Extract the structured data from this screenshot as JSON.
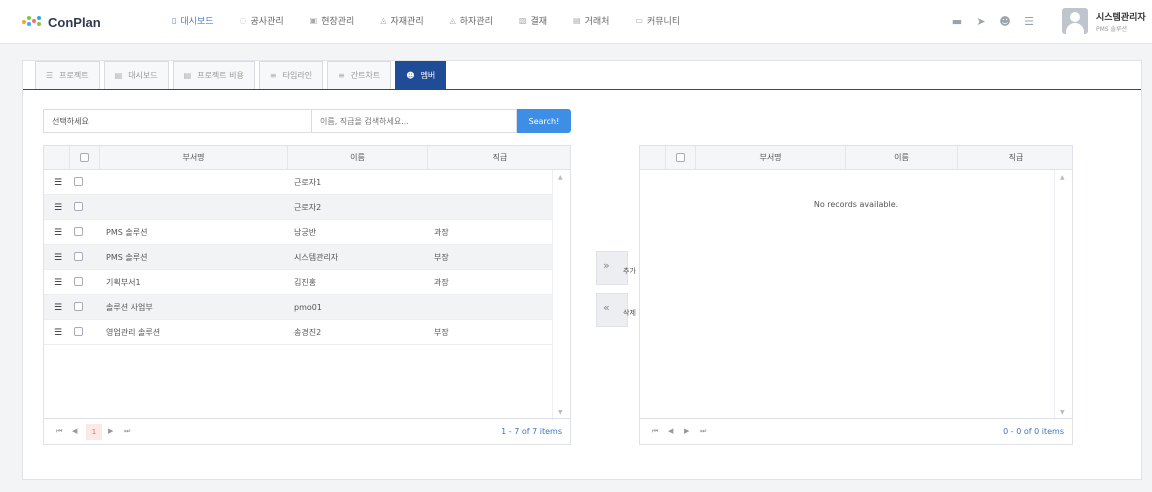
{
  "app": {
    "name": "ConPlan"
  },
  "nav": [
    {
      "label": "대시보드",
      "icon": "dashboard-icon",
      "glyph": "▯",
      "active": true
    },
    {
      "label": "공사관리",
      "icon": "circle-icon",
      "glyph": "◌",
      "active": false
    },
    {
      "label": "현장관리",
      "icon": "site-icon",
      "glyph": "▣",
      "active": false
    },
    {
      "label": "자재관리",
      "icon": "material-icon",
      "glyph": "◬",
      "active": false
    },
    {
      "label": "하자관리",
      "icon": "defect-icon",
      "glyph": "◬",
      "active": false
    },
    {
      "label": "결재",
      "icon": "approval-icon",
      "glyph": "▨",
      "active": false
    },
    {
      "label": "거래처",
      "icon": "client-icon",
      "glyph": "▤",
      "active": false
    },
    {
      "label": "커뮤니티",
      "icon": "community-icon",
      "glyph": "▭",
      "active": false
    }
  ],
  "user": {
    "name": "시스템관리자",
    "role": "PMS 솔루션"
  },
  "tabs": [
    {
      "label": "프로젝트",
      "icon": "list-icon",
      "glyph": "☰",
      "active": false
    },
    {
      "label": "대시보드",
      "icon": "doc-icon",
      "glyph": "▤",
      "active": false
    },
    {
      "label": "프로젝트 비용",
      "icon": "doc-icon",
      "glyph": "▤",
      "active": false
    },
    {
      "label": "타임라인",
      "icon": "timeline-icon",
      "glyph": "≡",
      "active": false
    },
    {
      "label": "간트차트",
      "icon": "gantt-icon",
      "glyph": "≡",
      "active": false
    },
    {
      "label": "멤버",
      "icon": "members-icon",
      "glyph": "☻",
      "active": true
    }
  ],
  "filter": {
    "select_value": "선택하세요",
    "search_placeholder": "이름, 직급을 검색하세요...",
    "search_label": "Search!"
  },
  "left_grid": {
    "columns": [
      "부서명",
      "이름",
      "직급"
    ],
    "rows": [
      {
        "dept": "",
        "name": "근로자1",
        "rank": ""
      },
      {
        "dept": "",
        "name": "근로자2",
        "rank": ""
      },
      {
        "dept": "PMS 솔루션",
        "name": "남궁반",
        "rank": "과장"
      },
      {
        "dept": "PMS 솔루션",
        "name": "시스템관리자",
        "rank": "부장"
      },
      {
        "dept": "기획부서1",
        "name": "김진홍",
        "rank": "과장"
      },
      {
        "dept": "솔루션 사업부",
        "name": "pmo01",
        "rank": ""
      },
      {
        "dept": "영업관리 솔루션",
        "name": "송경진2",
        "rank": "부장"
      }
    ],
    "page": "1",
    "pager_info": "1 - 7 of 7 items"
  },
  "right_grid": {
    "columns": [
      "부서명",
      "이름",
      "직급"
    ],
    "empty_text": "No records available.",
    "pager_info": "0 - 0 of 0 items"
  },
  "transfer": {
    "add_label": "추가",
    "remove_label": "삭제"
  },
  "colors": {
    "accent": "#1f4c96",
    "search": "#3d8fe6",
    "nav_active": "#4a7fd0"
  }
}
